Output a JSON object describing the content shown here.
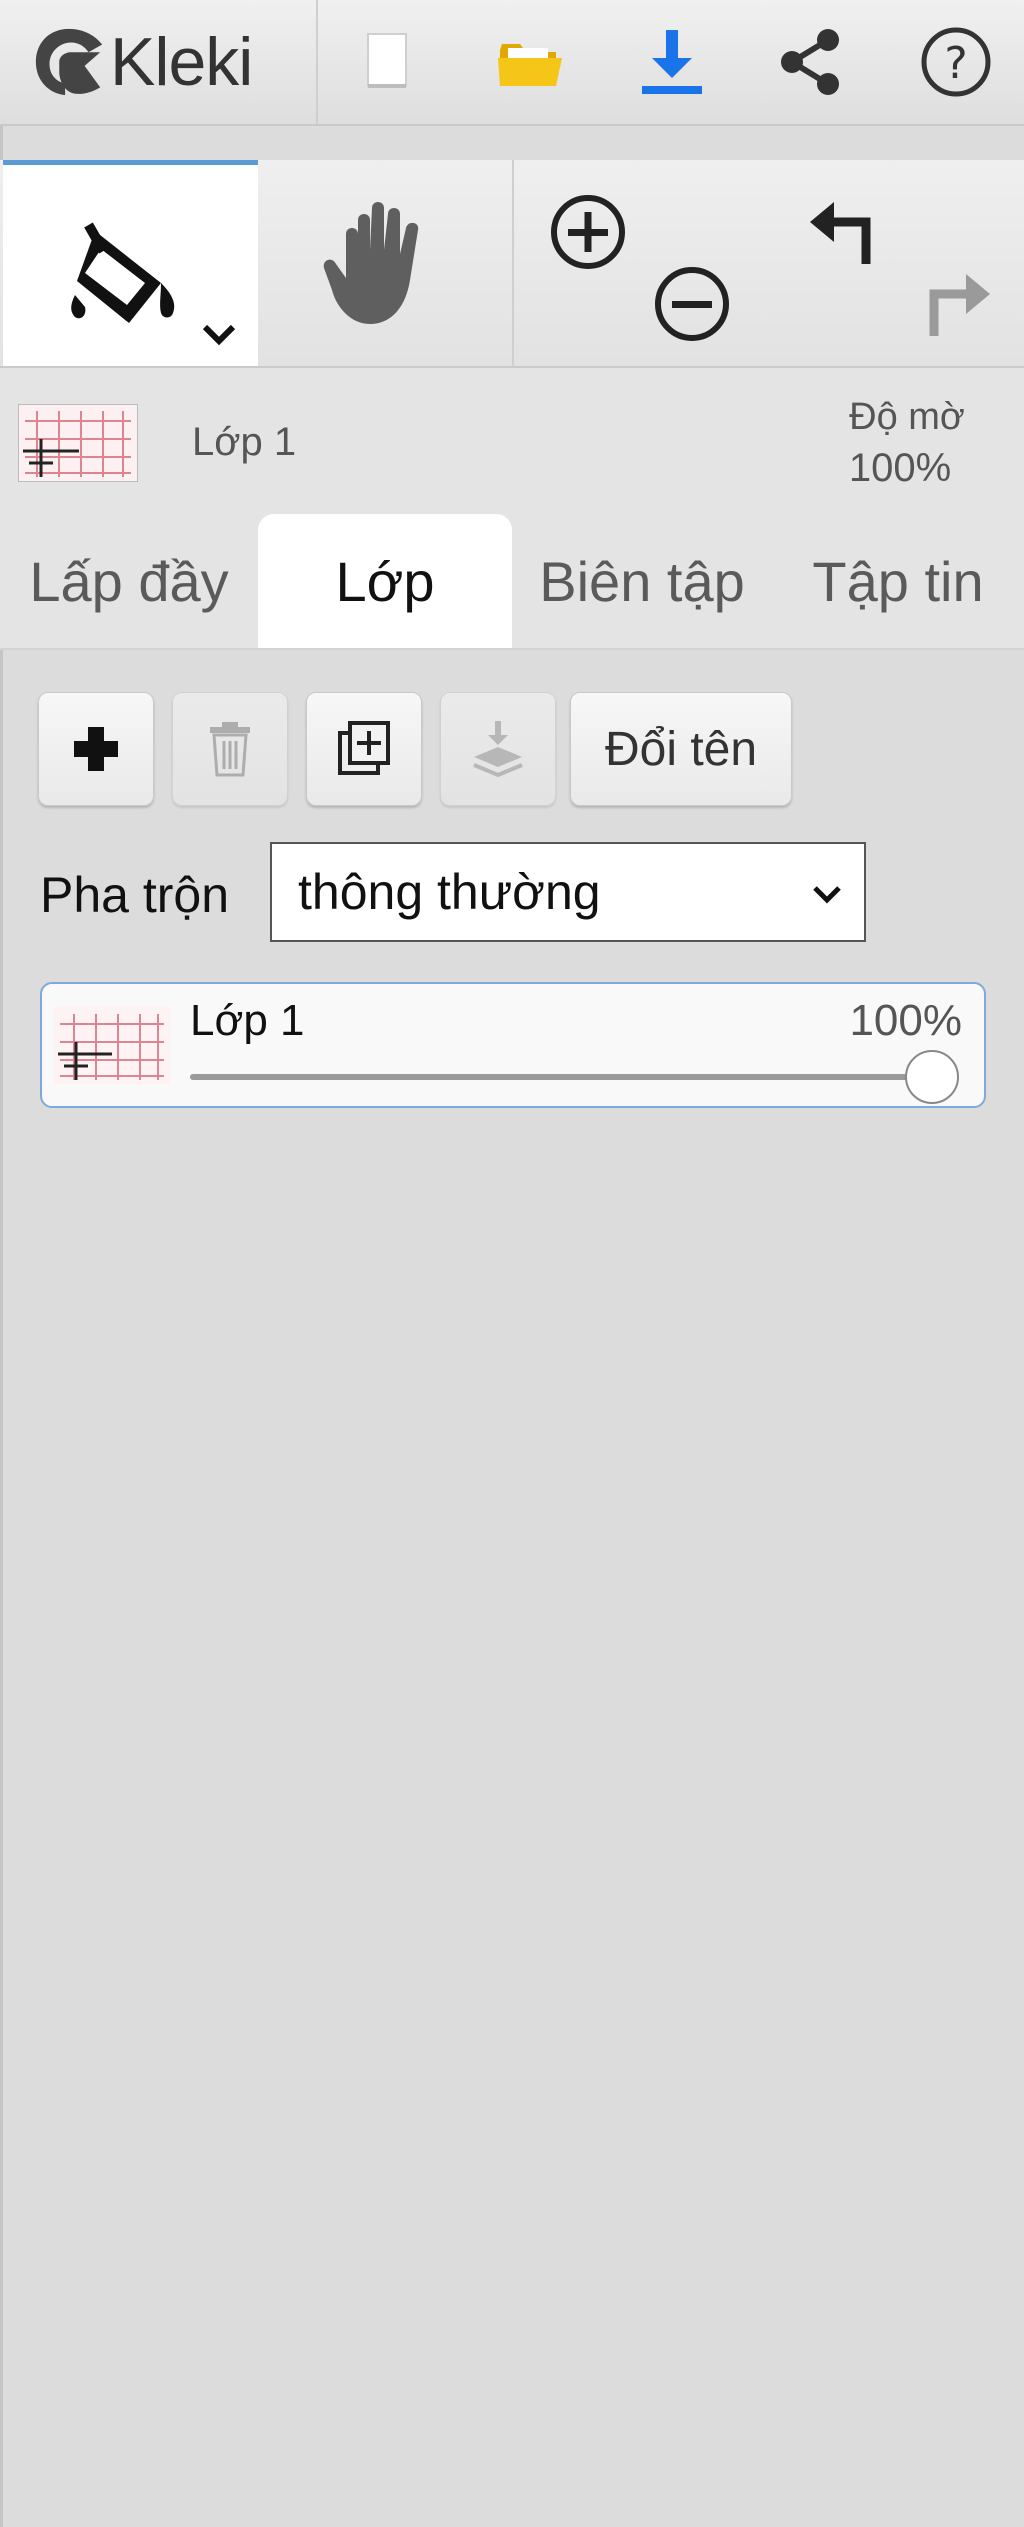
{
  "app": {
    "name": "Kleki"
  },
  "colors": {
    "accent": "#5b9bd5",
    "download": "#1a73e8",
    "folder": "#f5b800"
  },
  "top_icons": [
    "new-image-icon",
    "open-folder-icon",
    "download-icon",
    "share-icon",
    "help-icon"
  ],
  "toolbar": {
    "tools": [
      "paint-bucket-icon",
      "hand-icon",
      "zoom-in-icon",
      "zoom-out-icon",
      "undo-icon",
      "redo-icon"
    ],
    "active_tool": "paint-bucket-icon"
  },
  "layer_preview": {
    "name": "Lớp 1",
    "opacity_label": "Độ mờ",
    "opacity_value": "100%"
  },
  "tabs": [
    {
      "label": "Lấp đầy",
      "active": false
    },
    {
      "label": "Lớp",
      "active": true
    },
    {
      "label": "Biên tập",
      "active": false
    },
    {
      "label": "Tập tin",
      "active": false
    }
  ],
  "layer_actions": {
    "icons": [
      "plus-icon",
      "trash-icon",
      "duplicate-icon",
      "merge-down-icon"
    ],
    "rename_label": "Đổi tên"
  },
  "blend": {
    "label": "Pha trộn",
    "value": "thông thường"
  },
  "layers": [
    {
      "name": "Lớp 1",
      "opacity_text": "100%",
      "opacity": 1.0
    }
  ]
}
